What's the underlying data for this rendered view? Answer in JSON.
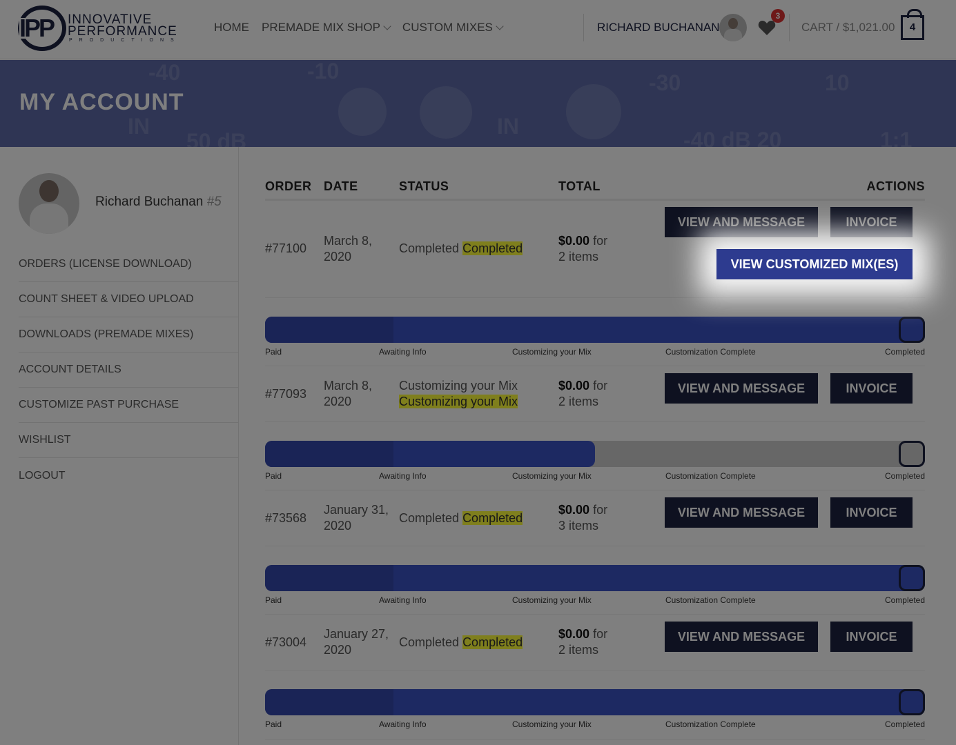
{
  "header": {
    "logo": {
      "mark": "IPP",
      "line1": "INNOVATIVE",
      "line2": "PERFORMANCE",
      "line3": "PRODUCTIONS"
    },
    "nav": [
      {
        "label": "HOME",
        "dropdown": false
      },
      {
        "label": "PREMADE MIX SHOP",
        "dropdown": true
      },
      {
        "label": "CUSTOM MIXES",
        "dropdown": true
      }
    ],
    "user_name": "RICHARD BUCHANAN",
    "wishlist_count": "3",
    "cart_label": "CART / $1,021.00",
    "cart_count": "4"
  },
  "hero": {
    "title": "MY ACCOUNT"
  },
  "sidebar": {
    "name": "Richard Buchanan",
    "id": "#5",
    "menu": [
      "ORDERS (LICENSE DOWNLOAD)",
      "COUNT SHEET & VIDEO UPLOAD",
      "DOWNLOADS (PREMADE MIXES)",
      "ACCOUNT DETAILS",
      "CUSTOMIZE PAST PURCHASE",
      "WISHLIST",
      "LOGOUT"
    ]
  },
  "table": {
    "headers": {
      "order": "ORDER",
      "date": "DATE",
      "status": "STATUS",
      "total": "TOTAL",
      "actions": "ACTIONS"
    },
    "buttons": {
      "view_message": "VIEW AND MESSAGE",
      "invoice": "INVOICE",
      "view_custom": "VIEW CUSTOMIZED MIX(ES)"
    },
    "stages": [
      "Paid",
      "Awaiting Info",
      "Customizing your Mix",
      "Customization Complete",
      "Completed"
    ],
    "orders": [
      {
        "number": "#77100",
        "date_line1": "March 8,",
        "date_line2": "2020",
        "status": "Completed",
        "status_hl": "Completed",
        "total": "$0.00",
        "for": "for",
        "items": "2 items",
        "progress": 1.0
      },
      {
        "number": "#77093",
        "date_line1": "March 8,",
        "date_line2": "2020",
        "status": "Customizing your Mix",
        "status_hl": "Customizing your Mix",
        "total": "$0.00",
        "for": "for",
        "items": "2 items",
        "progress": 0.5
      },
      {
        "number": "#73568",
        "date_line1": "January 31,",
        "date_line2": "2020",
        "status": "Completed",
        "status_hl": "Completed",
        "total": "$0.00",
        "for": "for",
        "items": "3 items",
        "progress": 1.0
      },
      {
        "number": "#73004",
        "date_line1": "January 27,",
        "date_line2": "2020",
        "status": "Completed",
        "status_hl": "Completed",
        "total": "$0.00",
        "for": "for",
        "items": "2 items",
        "progress": 1.0
      }
    ]
  }
}
